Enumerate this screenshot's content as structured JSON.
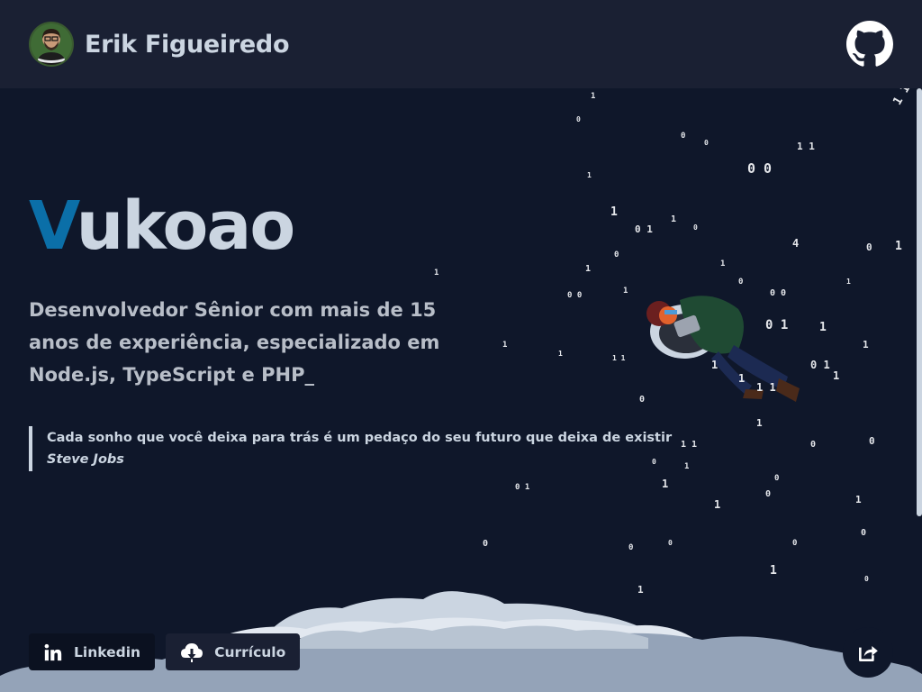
{
  "header": {
    "name": "Erik Figueiredo",
    "avatar_icon": "avatar-photo",
    "github_icon": "github-icon"
  },
  "hero": {
    "title_accent": "V",
    "title_rest": "ukoao",
    "subtitle": "Desenvolvedor Sênior com mais de 15 anos de experiência, especializado em Node.js, TypeScript e PHP_",
    "quote": "Cada sonho que você deixa para trás é um pedaço do seu futuro que deixa de existir",
    "quote_author": "Steve Jobs"
  },
  "actions": {
    "linkedin_label": "Linkedin",
    "linkedin_icon": "linkedin-icon",
    "curriculo_label": "Currículo",
    "curriculo_icon": "cloud-download-icon",
    "share_icon": "share-icon"
  },
  "colors": {
    "background": "#0f172a",
    "header": "#1a2033",
    "accent": "#0b6fa8",
    "text": "#cbd5e1"
  }
}
